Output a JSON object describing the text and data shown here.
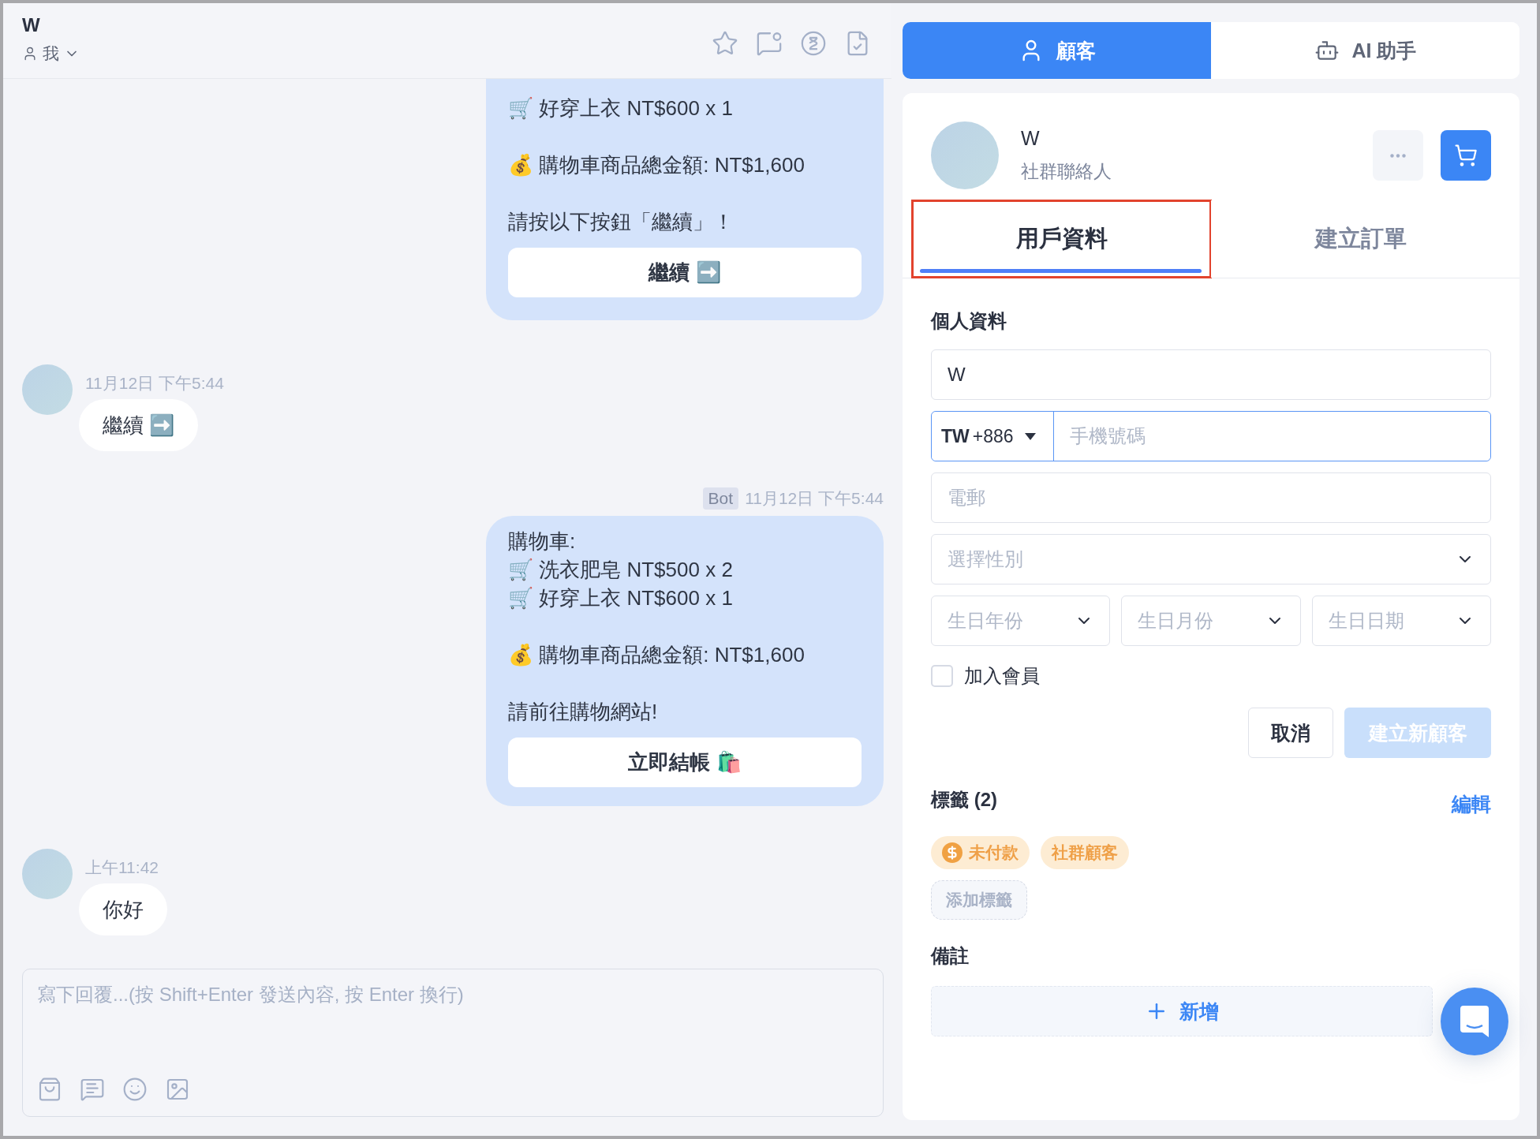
{
  "conversation": {
    "title": "W",
    "assignee": "我"
  },
  "messages": [
    {
      "kind": "bot",
      "clipped": true,
      "paragraphs": [
        [
          "🛒 好穿上衣 NT$600 x 1"
        ],
        [
          "💰 購物車商品總金額: NT$1,600"
        ],
        [
          "請按以下按鈕「繼續」！"
        ]
      ],
      "button": "繼續 ➡️"
    },
    {
      "kind": "customer",
      "time": "11月12日 下午5:44",
      "text": "繼續 ➡️"
    },
    {
      "kind": "bot",
      "clipped": false,
      "badge": "Bot",
      "time": "11月12日 下午5:44",
      "paragraphs": [
        [
          "購物車:",
          "🛒 洗衣肥皂 NT$500 x 2",
          "🛒 好穿上衣 NT$600 x 1"
        ],
        [
          "💰 購物車商品總金額: NT$1,600"
        ],
        [
          "請前往購物網站!"
        ]
      ],
      "button": "立即結帳 🛍️"
    },
    {
      "kind": "customer",
      "time": "上午11:42",
      "text": "你好"
    }
  ],
  "composer": {
    "placeholder": "寫下回覆...(按 Shift+Enter 發送內容, 按 Enter 換行)"
  },
  "panel_tabs": [
    {
      "label": "顧客",
      "kind": "customer",
      "selected": true
    },
    {
      "label": "AI 助手",
      "kind": "assistant",
      "selected": false
    }
  ],
  "customer": {
    "name": "W",
    "type": "社群聯絡人"
  },
  "customer_tabs": [
    {
      "label": "用戶資料",
      "selected": true,
      "highlighted": true
    },
    {
      "label": "建立訂單",
      "selected": false,
      "highlighted": false
    }
  ],
  "profile": {
    "title": "個人資料",
    "name_value": "W",
    "country_code": "TW",
    "dial_code": "+886",
    "phone_placeholder": "手機號碼",
    "phone_focused": true,
    "email_placeholder": "電郵",
    "gender_placeholder": "選擇性別",
    "birth_year_placeholder": "生日年份",
    "birth_month_placeholder": "生日月份",
    "birth_day_placeholder": "生日日期",
    "membership": {
      "label": "加入會員",
      "checked": false
    },
    "cancel": "取消",
    "submit": {
      "label": "建立新顧客",
      "disabled": true
    }
  },
  "tags": {
    "title": "標籤 (2)",
    "edit": "編輯",
    "items": [
      {
        "label": "未付款",
        "kind": "payment"
      },
      {
        "label": "社群顧客",
        "kind": "plain"
      }
    ],
    "add": "添加標籤"
  },
  "notes": {
    "title": "備註",
    "add": "新增"
  }
}
